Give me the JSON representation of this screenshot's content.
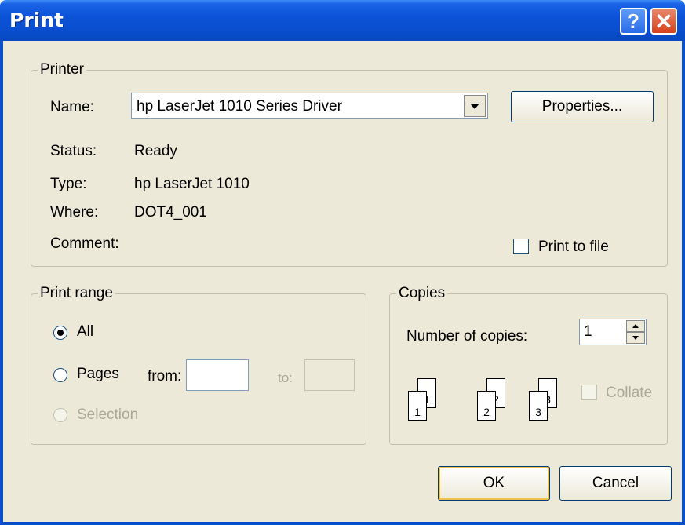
{
  "window": {
    "title": "Print",
    "help_glyph": "?",
    "close_glyph": "✕"
  },
  "printer": {
    "group_label": "Printer",
    "name_label": "Name:",
    "name_value": "hp LaserJet 1010 Series Driver",
    "properties_label": "Properties...",
    "status_label": "Status:",
    "status_value": "Ready",
    "type_label": "Type:",
    "type_value": "hp LaserJet 1010",
    "where_label": "Where:",
    "where_value": "DOT4_001",
    "comment_label": "Comment:",
    "comment_value": "",
    "print_to_file_label": "Print to file",
    "print_to_file_checked": false
  },
  "print_range": {
    "group_label": "Print range",
    "all_label": "All",
    "all_selected": true,
    "pages_label": "Pages",
    "from_label": "from:",
    "from_value": "",
    "to_label": "to:",
    "to_value": "",
    "selection_label": "Selection"
  },
  "copies": {
    "group_label": "Copies",
    "number_label": "Number of copies:",
    "number_value": "1",
    "collate_label": "Collate",
    "collate_checked": false,
    "collate_icon_pages": [
      "1",
      "1",
      "2",
      "2",
      "3",
      "3"
    ]
  },
  "buttons": {
    "ok_label": "OK",
    "cancel_label": "Cancel"
  },
  "colors": {
    "titlebar": "#0a4fcc",
    "dialog_face": "#ece9d8",
    "close_button": "#d5421e"
  }
}
